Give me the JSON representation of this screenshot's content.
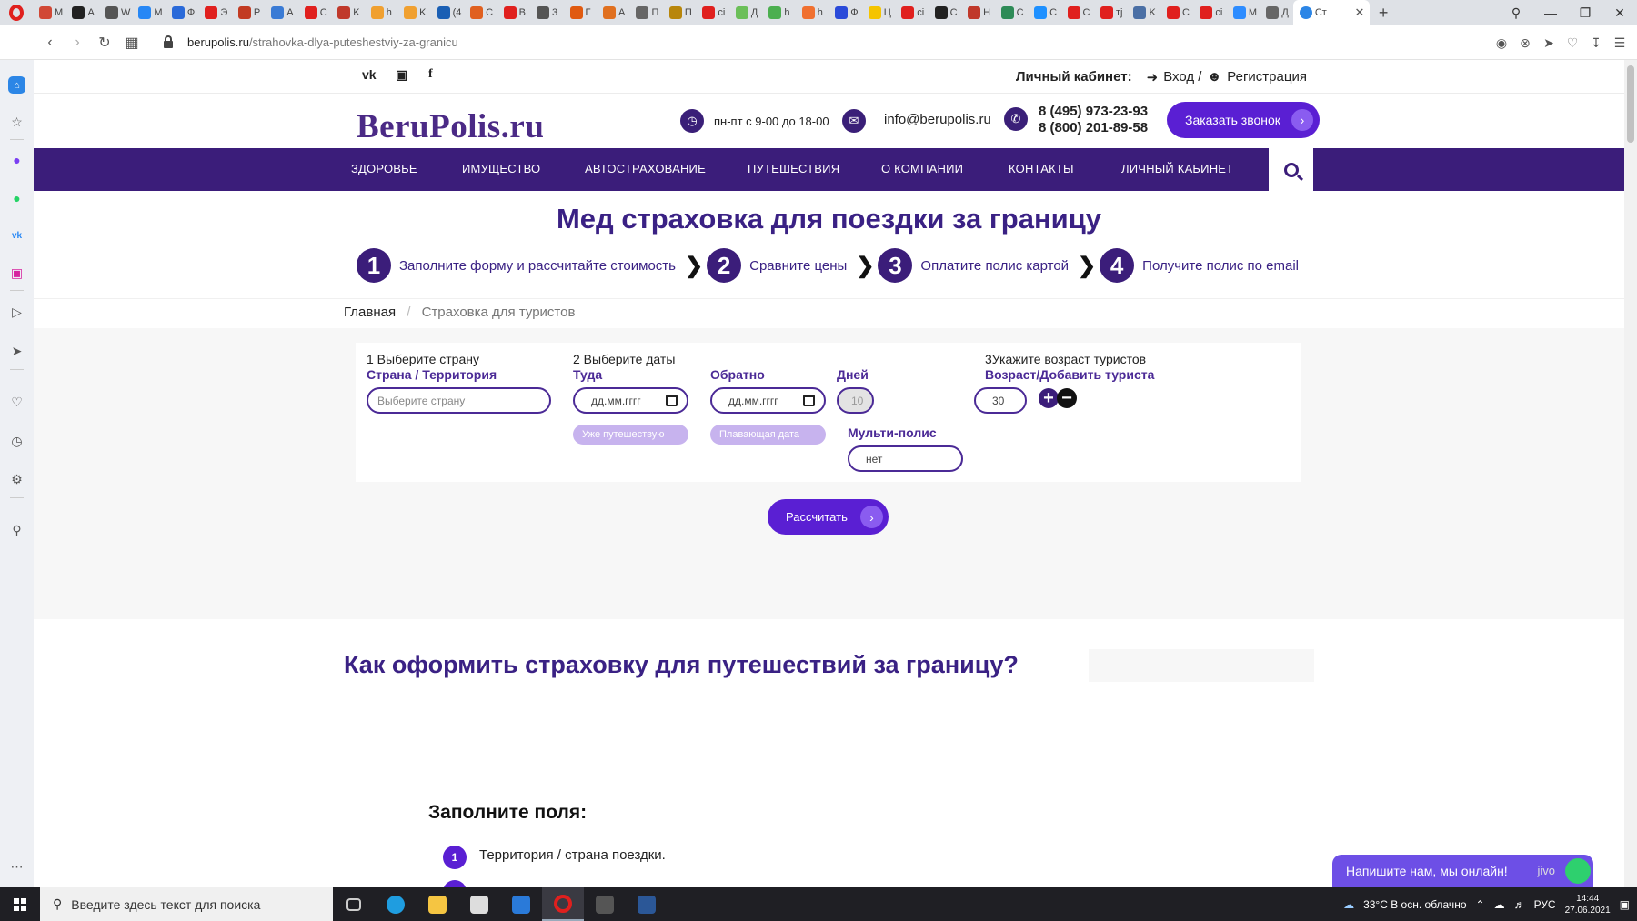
{
  "browser": {
    "active_tab_label": "Ст",
    "url_host": "berupolis.ru",
    "url_path": "/strahovka-dlya-puteshestviy-za-granicu",
    "tabs": [
      {
        "label": "M T",
        "color": "#d14836"
      },
      {
        "label": "A",
        "color": "#222222"
      },
      {
        "label": "W",
        "color": "#555555"
      },
      {
        "label": "M",
        "color": "#2787f5"
      },
      {
        "label": "Ф",
        "color": "#2a6ad9"
      },
      {
        "label": "Э",
        "color": "#e0201e"
      },
      {
        "label": "P",
        "color": "#c23b22"
      },
      {
        "label": "A",
        "color": "#3a7bd5"
      },
      {
        "label": "C",
        "color": "#e0201e"
      },
      {
        "label": "K",
        "color": "#c0392b"
      },
      {
        "label": "h",
        "color": "#f0a030"
      },
      {
        "label": "K",
        "color": "#f0a030"
      },
      {
        "label": "(4",
        "color": "#1a5fb4"
      },
      {
        "label": "C",
        "color": "#e06020"
      },
      {
        "label": "B",
        "color": "#e0201e"
      },
      {
        "label": "3",
        "color": "#555555"
      },
      {
        "label": "Г",
        "color": "#e05a10"
      },
      {
        "label": "A",
        "color": "#e07020"
      },
      {
        "label": "П",
        "color": "#666666"
      },
      {
        "label": "П",
        "color": "#b8860b"
      },
      {
        "label": "сі",
        "color": "#e0201e"
      },
      {
        "label": "Д",
        "color": "#6bbf59"
      },
      {
        "label": "h",
        "color": "#4caf50"
      },
      {
        "label": "h",
        "color": "#f07030"
      },
      {
        "label": "Ф",
        "color": "#2a4ad9"
      },
      {
        "label": "Ц",
        "color": "#f5c400"
      },
      {
        "label": "сі",
        "color": "#e0201e"
      },
      {
        "label": "C",
        "color": "#222222"
      },
      {
        "label": "H",
        "color": "#c0392b"
      },
      {
        "label": "C",
        "color": "#2e8b57"
      },
      {
        "label": "C",
        "color": "#1e90ff"
      },
      {
        "label": "C",
        "color": "#e0201e"
      },
      {
        "label": "тј",
        "color": "#e0201e"
      },
      {
        "label": "K",
        "color": "#4a6fa5"
      },
      {
        "label": "C",
        "color": "#e0201e"
      },
      {
        "label": "сі",
        "color": "#e0201e"
      },
      {
        "label": "M",
        "color": "#2d8cff"
      },
      {
        "label": "Д",
        "color": "#666666"
      }
    ]
  },
  "site": {
    "cabinet_label": "Личный кабинет:",
    "login": "Вход /",
    "register": "Регистрация",
    "logo": "BeruPolis.ru",
    "hours": "пн-пт с 9-00 до 18-00",
    "email": "info@berupolis.ru",
    "phone1": "8 (495) 973-23-93",
    "phone2": "8 (800) 201-89-58",
    "call_button": "Заказать звонок",
    "nav": [
      "ЗДОРОВЬЕ",
      "ИМУЩЕСТВО",
      "АВТОСТРАХОВАНИЕ",
      "ПУТЕШЕСТВИЯ",
      "О КОМПАНИИ",
      "КОНТАКТЫ",
      "ЛИЧНЫЙ КАБИНЕТ"
    ]
  },
  "title": "Мед страховка для поездки за границу",
  "steps": [
    {
      "num": "1",
      "text": "Заполните форму и рассчитайте стоимость"
    },
    {
      "num": "2",
      "text": "Сравните цены"
    },
    {
      "num": "3",
      "text": "Оплатите полис картой"
    },
    {
      "num": "4",
      "text": "Получите полис по email"
    }
  ],
  "breadcrumb": {
    "home": "Главная",
    "sep": "/",
    "current": "Страховка для туристов"
  },
  "form": {
    "country_step": "1 Выберите страну",
    "country_label": "Страна / Территория",
    "country_placeholder": "Выберите страну",
    "dates_step": "2 Выберите даты",
    "from_label": "Туда",
    "from_value": "дд.мм.гггг",
    "already_traveling": "Уже путешествую",
    "to_label": "Обратно",
    "to_value": "дд.мм.гггг",
    "floating_date": "Плавающая дата",
    "days_label": "Дней",
    "days_value": "10",
    "multi_label": "Мульти-полис",
    "multi_value": "нет",
    "age_step": "3Укажите возраст туристов",
    "age_label": "Возраст/Добавить туриста",
    "age_value": "30",
    "calc_button": "Рассчитать"
  },
  "how_title": "Как оформить страховку для путешествий за границу?",
  "fill_title": "Заполните поля:",
  "list": [
    {
      "num": "1",
      "text": "Территория / страна поездки."
    }
  ],
  "chat": {
    "text": "Напишите нам, мы онлайн!",
    "brand": "jivo"
  },
  "taskbar": {
    "search_placeholder": "Введите здесь текст для поиска",
    "weather": "33°C  В осн. облачно",
    "lang": "РУС",
    "time": "14:44",
    "date": "27.06.2021"
  }
}
